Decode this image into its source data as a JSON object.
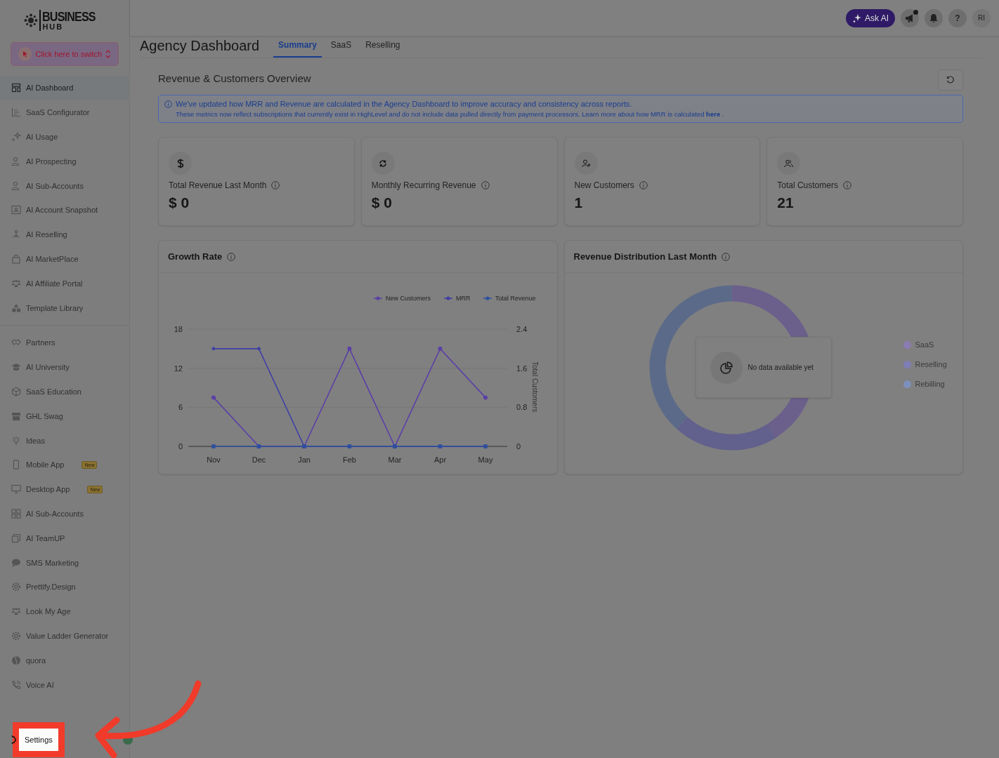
{
  "brand": {
    "line_1": "BUSINESS",
    "line_2": "HUB"
  },
  "switcher": {
    "label": "Click here to switch"
  },
  "sidebar": {
    "sections": [
      [
        {
          "label": "AI Dashboard",
          "selected": true
        },
        {
          "label": "SaaS Configurator",
          "selected": false
        },
        {
          "label": "AI Usage",
          "selected": false
        },
        {
          "label": "AI Prospecting",
          "selected": false
        },
        {
          "label": "AI Sub-Accounts",
          "selected": false
        },
        {
          "label": "AI Account Snapshot",
          "selected": false
        },
        {
          "label": "AI Reselling",
          "selected": false
        },
        {
          "label": "AI MarketPlace",
          "selected": false
        },
        {
          "label": "AI Affiliate Portal",
          "selected": false
        },
        {
          "label": "Template Library",
          "selected": false
        }
      ],
      [
        {
          "label": "Partners",
          "selected": false
        },
        {
          "label": "AI University",
          "selected": false
        },
        {
          "label": "SaaS Education",
          "selected": false
        },
        {
          "label": "GHL Swag",
          "selected": false
        },
        {
          "label": "Ideas",
          "selected": false
        },
        {
          "label": "Mobile App",
          "selected": false,
          "badge": "New"
        },
        {
          "label": "Desktop App",
          "selected": false,
          "badge": "New"
        },
        {
          "label": "AI Sub-Accounts",
          "selected": false
        },
        {
          "label": "AI TeamUP",
          "selected": false
        },
        {
          "label": "SMS Marketing",
          "selected": false
        },
        {
          "label": "Prettify.Design",
          "selected": false
        },
        {
          "label": "Look My Age",
          "selected": false
        },
        {
          "label": "Value Ladder Generator",
          "selected": false
        },
        {
          "label": "quora",
          "selected": false
        },
        {
          "label": "Voice AI",
          "selected": false
        }
      ]
    ],
    "footer": {
      "label": "Settings",
      "highlighted": true
    }
  },
  "topbar": {
    "ask_ai": "Ask AI",
    "notification_dot": true,
    "help": "?",
    "avatar": "RI"
  },
  "page": {
    "title": "Agency Dashboard",
    "tabs": [
      {
        "label": "Summary",
        "selected": true
      },
      {
        "label": "SaaS",
        "selected": false
      },
      {
        "label": "Reselling",
        "selected": false
      }
    ]
  },
  "overview": {
    "title": "Revenue & Customers Overview",
    "notice": {
      "headline": "We've updated how MRR and Revenue are calculated in the Agency Dashboard to improve accuracy and consistency across reports.",
      "body": "These metrics now reflect subscriptions that currently exist in HighLevel and do not include data pulled directly from payment processors. Learn more about how MRR is calculated",
      "link": "here",
      "tail": "."
    }
  },
  "stats": [
    {
      "kind": "dollar",
      "label": "Total Revenue Last Month",
      "value": "$ 0"
    },
    {
      "kind": "recurring",
      "label": "Monthly Recurring Revenue",
      "value": "$ 0"
    },
    {
      "kind": "new",
      "label": "New Customers",
      "value": "1"
    },
    {
      "kind": "total",
      "label": "Total Customers",
      "value": "21"
    }
  ],
  "growth": {
    "title": "Growth Rate",
    "chart_data": {
      "type": "line",
      "legend": "top-right",
      "categories": [
        "Nov",
        "Dec",
        "Jan",
        "Feb",
        "Mar",
        "Apr",
        "May"
      ],
      "ylim": [
        0,
        18
      ],
      "yticks": [
        0,
        6,
        12,
        18
      ],
      "y2label": "Total Customers",
      "y2lim": [
        0,
        2.4
      ],
      "y2ticks": [
        0,
        0.8,
        1.6,
        2.4
      ],
      "series": [
        {
          "name": "New Customers",
          "color": "#5b3fa6",
          "axis": "y2",
          "marker": "circle",
          "values": [
            1,
            0,
            0,
            2,
            0,
            2,
            1
          ]
        },
        {
          "name": "MRR",
          "color": "#3f3fa6",
          "marker": "diamond",
          "values": [
            15,
            15,
            0,
            0,
            0,
            0,
            0
          ]
        },
        {
          "name": "Total Revenue",
          "color": "#2f4f9f",
          "marker": "square",
          "values": [
            0,
            0,
            0,
            0,
            0,
            0,
            0
          ]
        }
      ]
    }
  },
  "distribution": {
    "title": "Revenue Distribution Last Month",
    "empty_message": "No data available yet",
    "legend": [
      {
        "label": "SaaS",
        "color": "#8b7bb3"
      },
      {
        "label": "Reselling",
        "color": "#7f7db5"
      },
      {
        "label": "Rebilling",
        "color": "#7d8fbd"
      }
    ]
  }
}
